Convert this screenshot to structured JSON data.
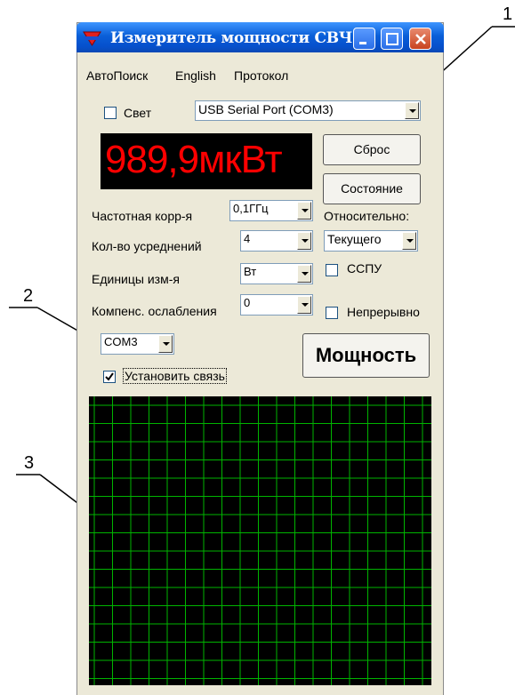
{
  "window": {
    "title": "Измеритель мощности СВЧ",
    "colors": {
      "title_bar": "#0a5fd8",
      "face": "#ece9d8",
      "display_bg": "#000000",
      "display_text": "#ff0000",
      "grid_line": "#00b400"
    }
  },
  "menu": {
    "items": [
      "АвтоПоиск",
      "English",
      "Протокол"
    ]
  },
  "light_checkbox": {
    "label": "Свет",
    "checked": false
  },
  "port_select": {
    "value": "USB Serial Port (COM3)"
  },
  "display": {
    "reading": "989,9мкВт"
  },
  "buttons": {
    "reset": "Сброс",
    "status": "Состояние",
    "power": "Мощность"
  },
  "settings": {
    "freq_label": "Частотная корр-я",
    "freq_value": "0,1ГГц",
    "avg_label": "Кол-во усреднений",
    "avg_value": "4",
    "units_label": "Единицы изм-я",
    "units_value": "Вт",
    "atten_label": "Компенс. ослабления",
    "atten_value": "0"
  },
  "relative": {
    "label": "Относительно:",
    "value": "Текущего"
  },
  "sspu_checkbox": {
    "label": "ССПУ",
    "checked": false
  },
  "continuous_checkbox": {
    "label": "Непрерывно",
    "checked": false
  },
  "com_select": {
    "value": "COM3"
  },
  "connect_checkbox": {
    "label": "Установить связь",
    "checked": true
  },
  "annotations": [
    "1",
    "2",
    "3"
  ]
}
